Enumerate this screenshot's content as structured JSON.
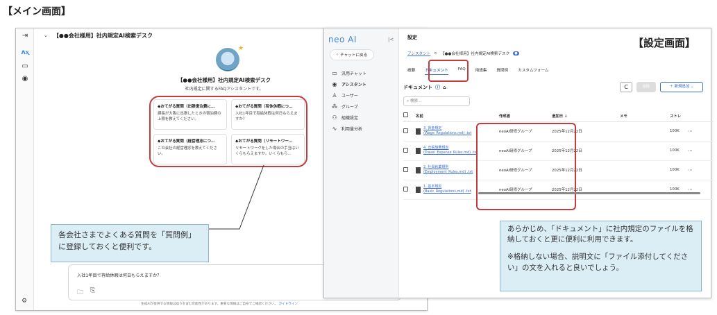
{
  "page_title": "【メイン画面】",
  "main": {
    "header_title": "【●●会社様用】社内規定AI検索デスク",
    "bot_title": "【●●会社様用】社内規定AI検索デスク",
    "bot_subtitle": "社内規定に関するFAQアシスタントです。",
    "faq": [
      {
        "q": "◆おてがる質問（出張復泊費に…",
        "a": "課長が大阪に出張したときの宿泊費の上限を教えてください。"
      },
      {
        "q": "◆おてがる質問（有休休暇につ…",
        "a": "入社1年目で有給休暇は何日もらえますか？"
      },
      {
        "q": "◆おてがる質問（経営理念につ…",
        "a": "この会社の経営理念を教えてください。"
      },
      {
        "q": "◆おてがる質問（リモートワー…",
        "a": "リモートワークをした場合の手当はいくらもらえますか。いくらもら…"
      }
    ],
    "chat_input": "入社1年目で有給休暇は何日もらえますか？",
    "footer_note": "生成AIが提供する情報は誤りを含む可能性があります。重要な情報はご自身でご確認ください。",
    "footer_link": "ガイドライン"
  },
  "callout_main": "各会社さまでよくある質問を「質問例」に登録しておくと便利です。",
  "settings": {
    "logo": "neo AI",
    "back_label": "チャットに戻る",
    "nav": [
      "汎用チャット",
      "アシスタント",
      "ユーザー",
      "グループ",
      "組織設定",
      "利用量分析"
    ],
    "heading": "設定",
    "title_label": "【設定画面】",
    "breadcrumb": {
      "root": "アシスタント",
      "sep": ">",
      "current": "【●●会社様用】社内規定AI検索デスク",
      "badge": "●"
    },
    "tabs": [
      "概要",
      "ドキュメント",
      "FAQ",
      "用語集",
      "質問例",
      "カスタムフォーム"
    ],
    "doc_heading": "ドキュメント",
    "buttons": {
      "refresh": "C",
      "delete": "削除",
      "add": "＋ 新規追加 ⌄"
    },
    "search_placeholder": "検索...",
    "columns": [
      "名前",
      "作成者",
      "追加日 ↓",
      "メモ",
      "ストレ"
    ],
    "rows": [
      {
        "name1": "3. 賃金規定",
        "name2": "(Wage_Regulations.md) .txt",
        "author": "neoAI研修グループ",
        "date": "2025年12月22日",
        "size": "100K"
      },
      {
        "name1": "4. 出張旅費規定",
        "name2": "(Travel_Expense_Rules.md) .txt",
        "author": "neoAI研修グループ",
        "date": "2025年12月22日",
        "size": "100K"
      },
      {
        "name1": "2. 社員就業規則",
        "name2": "(Employment_Rules.md) .txt",
        "author": "neoAI研修グループ",
        "date": "2025年12月22日",
        "size": "100K"
      },
      {
        "name1": "1. 基本規定",
        "name2": "(Basic_Regulations.md) .txt",
        "author": "neoAI研修グループ",
        "date": "2025年12月22日",
        "size": "100K"
      }
    ]
  },
  "callout_settings": "あらかじめ、「ドキュメント」に社内規定のファイルを格納しておくと更に便利に利用できます。",
  "callout_settings_note": "※格納しない場合、説明文に「ファイル添付してください」の文を入れると良いでしょう。"
}
